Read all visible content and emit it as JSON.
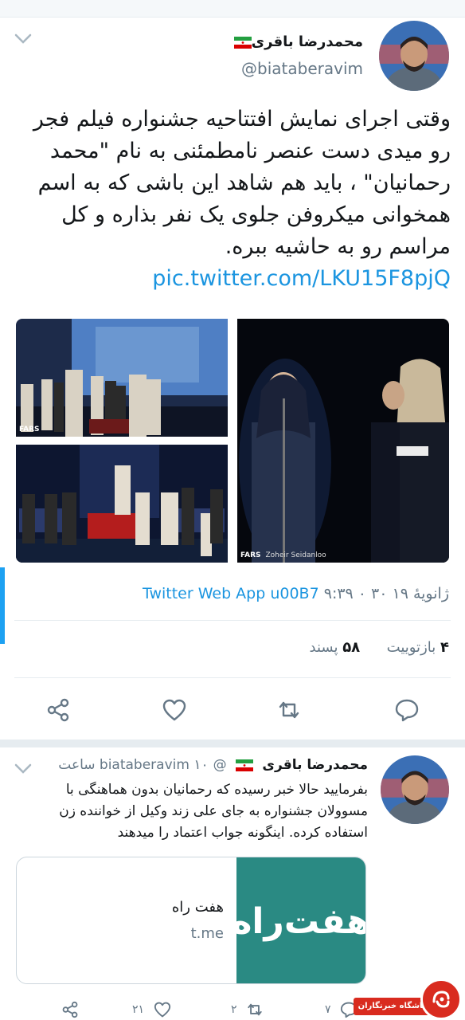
{
  "tweet": {
    "display_name": "محمدرضا باقری",
    "handle": "@biataberavim",
    "text": "وقتی اجرای نمایش افتتاحیه جشنواره فیلم فجر رو میدی دست عنصر نامطمئنی به نام \"محمد رحمانیان\" ، باید هم شاهد این باشی که به اسم همخوانی میکروفن جلوی یک نفر بذاره و کل مراسم رو به حاشیه ببره.",
    "link": "pic.twitter.com/LKU15F8pjQ",
    "photo_credit": {
      "agency": "FARS",
      "photographer": "Zoheir Seidanloo"
    },
    "timestamp": "۹:۳۹ ۰ ۳۰ ژانویهٔ ۱۹",
    "via": "Twitter Web App u00B7",
    "stats": {
      "retweets_count": "۴",
      "retweets_label": "بازتوییت",
      "likes_count": "۵۸",
      "likes_label": "پسند"
    },
    "actions": [
      "reply-icon",
      "retweet-icon",
      "like-icon",
      "share-icon"
    ]
  },
  "second_tweet": {
    "display_name": "محمدرضا باقری",
    "handle": "@biataberavim",
    "time": "۱۰ ساعت",
    "text": "بفرمایید حالا خبر رسیده که رحمانیان بدون هماهنگی با مسوولان جشنواره به جای علی زند وکیل از خواننده زن استفاده کرده. اینگونه جواب اعتماد را میدهند",
    "card": {
      "title": "هفت راه",
      "domain": "t.me",
      "thumb_text": "هفت‌راه"
    },
    "counts": {
      "reply": "۷",
      "retweet": "۲",
      "like": "۲۱"
    }
  },
  "watermark": {
    "label": "باشگاه خبرنگاران"
  },
  "colors": {
    "accent": "#1da1f2",
    "link": "#1b95e0",
    "muted": "#657786",
    "brand_red": "#d92b1f"
  }
}
